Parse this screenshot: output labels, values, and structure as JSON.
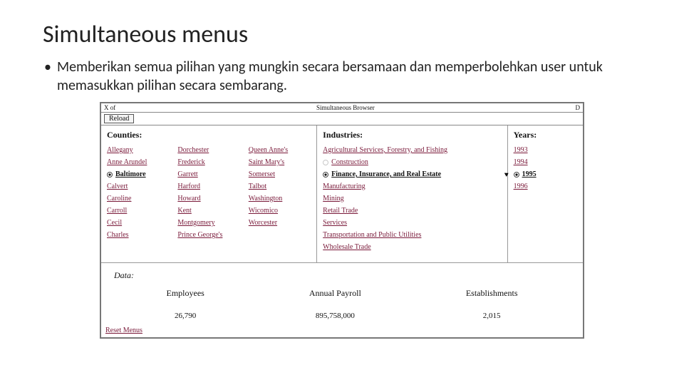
{
  "slide": {
    "title": "Simultaneous menus",
    "bullet": "Memberikan semua pilihan yang mungkin secara bersamaan dan memperbolehkan user untuk memasukkan pilihan secara sembarang."
  },
  "frame": {
    "top_left": "X of",
    "top_center": "Simultaneous Browser",
    "top_right": "D",
    "reload": "Reload"
  },
  "panels": {
    "counties": {
      "title": "Counties:",
      "col1": [
        "Allegany",
        "Anne Arundel",
        "Baltimore",
        "Calvert",
        "Caroline",
        "Carroll",
        "Cecil",
        "Charles"
      ],
      "col1_selected_index": 2,
      "col2": [
        "Dorchester",
        "Frederick",
        "Garrett",
        "Harford",
        "Howard",
        "Kent",
        "Montgomery",
        "Prince George's"
      ],
      "col3": [
        "Queen Anne's",
        "Saint Mary's",
        "Somerset",
        "Talbot",
        "Washington",
        "Wicomico",
        "Worcester"
      ]
    },
    "industries": {
      "title": "Industries:",
      "items": [
        "Agricultural Services, Forestry, and Fishing",
        "Construction",
        "Finance, Insurance, and Real Estate",
        "Manufacturing",
        "Mining",
        "Retail Trade",
        "Services",
        "Transportation and Public Utilities",
        "Wholesale Trade"
      ],
      "selected_index": 2
    },
    "years": {
      "title": "Years:",
      "items": [
        "1993",
        "1994",
        "1995",
        "1996"
      ],
      "selected_index": 2
    }
  },
  "data": {
    "title": "Data:",
    "headers": [
      "Employees",
      "Annual Payroll",
      "Establishments"
    ],
    "values": [
      "26,790",
      "895,758,000",
      "2,015"
    ]
  },
  "reset": "Reset Menus"
}
